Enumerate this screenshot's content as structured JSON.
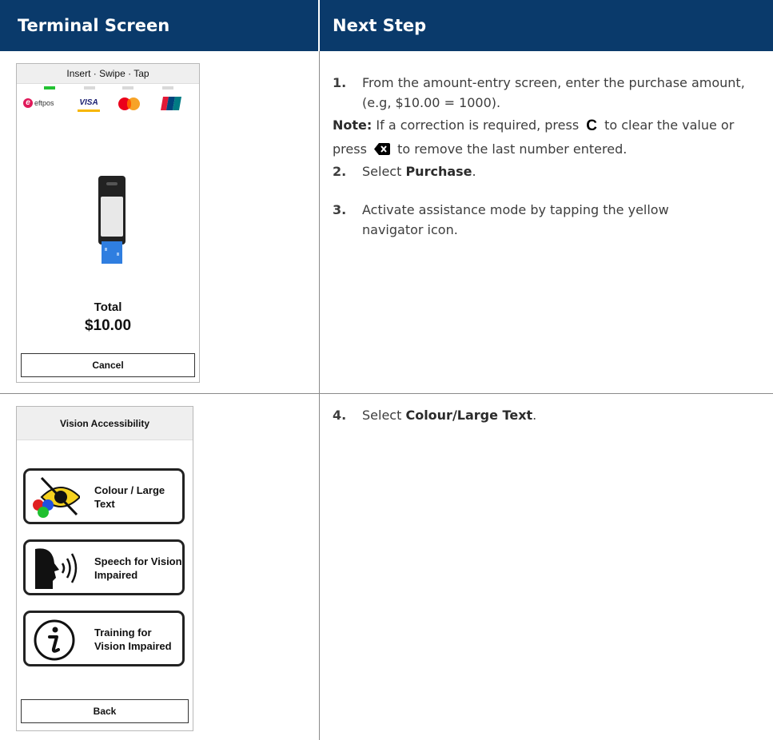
{
  "headers": {
    "left": "Terminal Screen",
    "right": "Next Step"
  },
  "screen1": {
    "title": "Insert · Swipe · Tap",
    "logos": {
      "eftpos": "eftpos",
      "visa": "VISA",
      "unionpay": "UnionPay",
      "unionpay_cn": "银联"
    },
    "total_label": "Total",
    "total_value": "$10.00",
    "cancel_label": "Cancel"
  },
  "screen2": {
    "title": "Vision Accessibility",
    "options": [
      {
        "label": "Colour / Large Text",
        "icon": "colour-eye-icon"
      },
      {
        "label": "Speech for Vision Impaired",
        "icon": "speaking-head-icon"
      },
      {
        "label": "Training for Vision Impaired",
        "icon": "info-icon"
      }
    ],
    "back_label": "Back"
  },
  "steps": {
    "s1": {
      "num": "1.",
      "text": "From the amount-entry screen, enter the purchase amount, (e.g, $10.00 = 1000)."
    },
    "note": {
      "label": "Note:",
      "part1": "If a correction is required, press",
      "key": "C",
      "part2": "to clear the value or press",
      "part3": "to remove the last number entered."
    },
    "s2": {
      "num": "2.",
      "pre": "Select ",
      "bold": "Purchase",
      "post": "."
    },
    "s3": {
      "num": "3.",
      "text": "Activate assistance mode by tapping the yellow navigator icon."
    },
    "s4": {
      "num": "4.",
      "pre": "Select ",
      "bold": "Colour/Large Text",
      "post": "."
    }
  },
  "colors": {
    "header_bg": "#0a3a6b",
    "active_indicator": "#22c232"
  }
}
